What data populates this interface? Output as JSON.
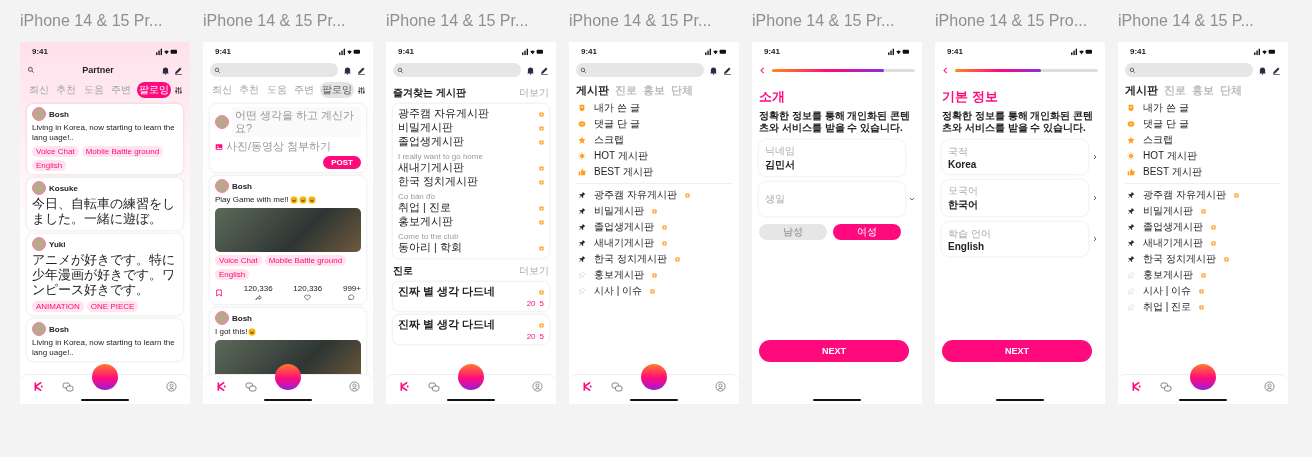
{
  "frames": [
    {
      "kind": "feed",
      "title": "iPhone 14 & 15 Pr...",
      "time": "9:41",
      "header": "Partner",
      "filter_tabs": [
        {
          "label": "최신",
          "selected": false
        },
        {
          "label": "추천",
          "selected": false
        },
        {
          "label": "도움",
          "selected": false
        },
        {
          "label": "주변",
          "selected": false
        },
        {
          "label": "팔로잉",
          "selected": true
        }
      ],
      "posts": [
        {
          "name": "Bosh",
          "text": "Living in Korea, now starting to learn the lang uage!..",
          "tags": [
            "Voice Chat",
            "Mobile Battle ground",
            "English"
          ]
        },
        {
          "name": "Kosuke",
          "text": "今日、自転車の練習をしました。一緒に遊ぼ。"
        },
        {
          "name": "Yuki",
          "text": "アニメが好きです。特に少年漫画が好きです。ワンピース好きです。",
          "tags": [
            "ANIMATION",
            "ONE PIECE"
          ]
        },
        {
          "name": "Bosh",
          "text": "Living in Korea, now starting to learn the lang uage!.."
        }
      ]
    },
    {
      "kind": "feed-detail",
      "title": "iPhone 14 & 15 Pr...",
      "time": "9:41",
      "filter_tabs": [
        {
          "label": "최신",
          "selected": false
        },
        {
          "label": "추천",
          "selected": false
        },
        {
          "label": "도움",
          "selected": false
        },
        {
          "label": "주변",
          "selected": false
        },
        {
          "label": "팔로잉",
          "selected": true
        }
      ],
      "composer": {
        "placeholder": "어떤 생각을 하고 계신가요?",
        "attach": "사진/동영상 첨부하기",
        "button": "POST"
      },
      "posts": [
        {
          "name": "Bosh",
          "text": "Play Game with me!!",
          "emojis": [
            {
              "kind": "laugh"
            },
            {
              "kind": "laugh"
            },
            {
              "kind": "laugh"
            }
          ],
          "photo": true,
          "tags": [
            "Voice Chat",
            "Mobile Battle ground",
            "English"
          ],
          "counts": [
            "120,336",
            "120,336",
            "999+"
          ]
        },
        {
          "name": "Bosh",
          "text": "I got this!",
          "emojis": [
            {
              "kind": "laugh"
            }
          ],
          "photo": true
        }
      ]
    },
    {
      "kind": "boards-home",
      "title": "iPhone 14 & 15 Pr...",
      "time": "9:41",
      "favorites": {
        "heading": "즐겨찾는 게시판",
        "more": "더보기",
        "rows": [
          {
            "name": "광주캠 자유게시판"
          },
          {
            "name": "비밀게시판"
          },
          {
            "name": "졸업생게시판",
            "preview": "I really want to go home"
          },
          {
            "name": "새내기게시판"
          },
          {
            "name": "한국 정치게시판",
            "preview": "Co bán đồ"
          },
          {
            "name": "취업 | 진로"
          },
          {
            "name": "홍보게시판",
            "preview": "Come to the club"
          },
          {
            "name": "동아리 | 학회"
          }
        ]
      },
      "career": {
        "heading": "진로",
        "more": "더보기",
        "posts": [
          {
            "title": "진짜 별 생각 다드네",
            "likes": "20",
            "comments": "5"
          },
          {
            "title": "진짜 별 생각 다드네",
            "likes": "20",
            "comments": "5"
          }
        ]
      }
    },
    {
      "kind": "board-menu",
      "title": "iPhone 14 & 15 Pr...",
      "time": "9:41",
      "tabs": [
        {
          "label": "게시판",
          "selected": true
        },
        {
          "label": "진로",
          "selected": false
        },
        {
          "label": "홍보",
          "selected": false
        },
        {
          "label": "단체",
          "selected": false
        }
      ],
      "shortcuts": [
        {
          "label": "내가 쓴 글",
          "kind": "doc"
        },
        {
          "label": "댓글 단 글",
          "kind": "comment"
        },
        {
          "label": "스크랩",
          "kind": "star"
        },
        {
          "label": "HOT 게시판",
          "kind": "hot"
        },
        {
          "label": "BEST 게시판",
          "kind": "thumb"
        }
      ],
      "boards": [
        {
          "label": "광주캠 자유게시판",
          "pinned": true
        },
        {
          "label": "비밀게시판",
          "pinned": true
        },
        {
          "label": "졸업생게시판",
          "pinned": true
        },
        {
          "label": "새내기게시판",
          "pinned": true
        },
        {
          "label": "한국 정치게시판",
          "pinned": true
        },
        {
          "label": "홍보게시판",
          "pinned": false
        },
        {
          "label": "시사 | 이슈",
          "pinned": false
        }
      ]
    },
    {
      "kind": "form",
      "title": "iPhone 14 & 15 Pr...",
      "time": "9:41",
      "progress": {
        "level": 0.78
      },
      "heading": "소개",
      "description": "정확한 정보를 통해 개인화된 콘텐츠와 서비스를 받을 수 있습니다.",
      "fields": [
        {
          "label": "닉네임",
          "value": "김민서",
          "kind": "text"
        },
        {
          "label": "생일",
          "kind": "select"
        }
      ],
      "options": [
        {
          "label": "남성",
          "selected": false
        },
        {
          "label": "여성",
          "selected": true
        }
      ],
      "button": "NEXT"
    },
    {
      "kind": "form",
      "title": "iPhone 14 & 15 Pro...",
      "time": "9:41",
      "progress": {
        "level": 0.6
      },
      "heading": "기본 정보",
      "description": "정확한 정보를 통해 개인화된 콘텐츠와 서비스를 받을 수 있습니다.",
      "fields": [
        {
          "label": "국적",
          "value": "Korea",
          "kind": "link"
        },
        {
          "label": "모국어",
          "value": "한국어",
          "kind": "link"
        },
        {
          "label": "학습 언어",
          "value": "English",
          "kind": "link"
        }
      ],
      "button": "NEXT"
    },
    {
      "kind": "board-menu",
      "title": "iPhone 14 & 15 P...",
      "time": "9:41",
      "tabs": [
        {
          "label": "게시판",
          "selected": true
        },
        {
          "label": "진로",
          "selected": false
        },
        {
          "label": "홍보",
          "selected": false
        },
        {
          "label": "단체",
          "selected": false
        }
      ],
      "shortcuts": [
        {
          "label": "내가 쓴 글",
          "kind": "doc"
        },
        {
          "label": "댓글 단 글",
          "kind": "comment"
        },
        {
          "label": "스크랩",
          "kind": "star"
        },
        {
          "label": "HOT 게시판",
          "kind": "hot"
        },
        {
          "label": "BEST 게시판",
          "kind": "thumb"
        }
      ],
      "boards": [
        {
          "label": "광주캠 자유게시판",
          "pinned": true
        },
        {
          "label": "비밀게시판",
          "pinned": true
        },
        {
          "label": "졸업생게시판",
          "pinned": true
        },
        {
          "label": "새내기게시판",
          "pinned": true
        },
        {
          "label": "한국 정치게시판",
          "pinned": true
        },
        {
          "label": "홍보게시판",
          "pinned": false
        },
        {
          "label": "시사 | 이슈",
          "pinned": false
        },
        {
          "label": "취업 | 진로",
          "pinned": false
        }
      ]
    }
  ]
}
